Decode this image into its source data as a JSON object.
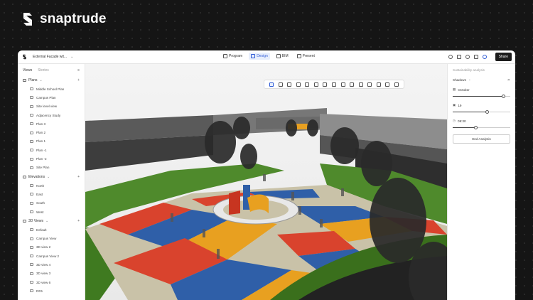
{
  "brand": {
    "name": "snaptrude"
  },
  "window": {
    "project_title": "External Facade wit..."
  },
  "modes": [
    {
      "label": "Program",
      "icon": "program-icon",
      "active": false
    },
    {
      "label": "Design",
      "icon": "design-icon",
      "active": true
    },
    {
      "label": "BIM",
      "icon": "bim-icon",
      "active": false
    },
    {
      "label": "Present",
      "icon": "present-icon",
      "active": false
    }
  ],
  "topbar_right": {
    "share_label": "Share",
    "icons": [
      "comment-icon",
      "list-icon",
      "history-icon",
      "fullscreen-icon",
      "settings-icon"
    ]
  },
  "left_panel": {
    "tabs": {
      "views": "Views",
      "stories": "Stories"
    },
    "sections": [
      {
        "label": "Plans",
        "items": [
          "Middle School Plan",
          "Campus Plan",
          "Site level view",
          "Adjacency Study",
          "Plan 3",
          "Plan 2",
          "Plan 1",
          "Plan -1",
          "Plan -2",
          "Site Plan"
        ]
      },
      {
        "label": "Elevations",
        "items": [
          "North",
          "East",
          "South",
          "West"
        ]
      },
      {
        "label": "3D Views",
        "items": [
          "Default",
          "Campus View",
          "3D view 2",
          "Campus View 2",
          "3D view 4",
          "3D view 3",
          "3D view 6",
          "DD1"
        ]
      }
    ]
  },
  "right_panel": {
    "title": "Sustainability analysis",
    "shadows_label": "Shadows",
    "month": {
      "label": "October",
      "value": 0.88
    },
    "day": {
      "label": "19",
      "value": 0.6
    },
    "time": {
      "label": "09:30",
      "value": 0.4
    },
    "end_button": "End Analysis"
  },
  "toolbar": {
    "tools": [
      "select-tool-icon",
      "line-tool-icon",
      "arc-tool-icon",
      "circle-tool-icon",
      "rectangle-tool-icon",
      "polygon-tool-icon",
      "move-tool-icon",
      "copy-tool-icon",
      "rotate-tool-icon",
      "scale-tool-icon",
      "array-tool-icon",
      "align-tool-icon",
      "measure-tool-icon",
      "paint-tool-icon",
      "dimension-tool-icon"
    ]
  },
  "colors": {
    "accent": "#2e5bd6",
    "dark": "#151515"
  }
}
